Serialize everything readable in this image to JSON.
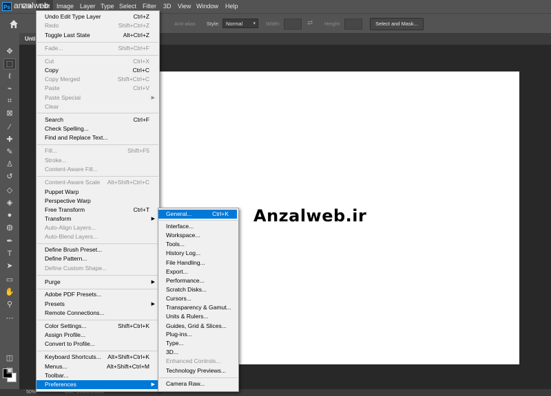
{
  "app": {
    "logo": "Ps",
    "watermark": "anzalweb"
  },
  "menubar": {
    "items": [
      "File",
      "Edit",
      "Image",
      "Layer",
      "Type",
      "Select",
      "Filter",
      "3D",
      "View",
      "Window",
      "Help"
    ]
  },
  "options_bar": {
    "anti_alias": "Anti-alias",
    "style_label": "Style:",
    "style_value": "Normal",
    "width_label": "Width:",
    "height_label": "Height:",
    "select_mask_button": "Select and Mask..."
  },
  "document": {
    "tab_title": "Unti",
    "canvas_text": "Anzalweb.ir"
  },
  "status": {
    "zoom": "50%",
    "doc_info": "Doc: 9/01M/2/00M"
  },
  "edit_menu": {
    "items": [
      {
        "label": "Undo Edit Type Layer",
        "shortcut": "Ctrl+Z"
      },
      {
        "label": "Redo",
        "shortcut": "Shift+Ctrl+Z"
      },
      {
        "label": "Toggle Last State",
        "shortcut": "Alt+Ctrl+Z"
      },
      {
        "label": "Fade...",
        "shortcut": "Shift+Ctrl+F"
      },
      {
        "label": "Cut",
        "shortcut": "Ctrl+X"
      },
      {
        "label": "Copy",
        "shortcut": "Ctrl+C"
      },
      {
        "label": "Copy Merged",
        "shortcut": "Shift+Ctrl+C"
      },
      {
        "label": "Paste",
        "shortcut": "Ctrl+V"
      },
      {
        "label": "Paste Special",
        "shortcut": ""
      },
      {
        "label": "Clear",
        "shortcut": ""
      },
      {
        "label": "Search",
        "shortcut": "Ctrl+F"
      },
      {
        "label": "Check Spelling...",
        "shortcut": ""
      },
      {
        "label": "Find and Replace Text...",
        "shortcut": ""
      },
      {
        "label": "Fill...",
        "shortcut": "Shift+F5"
      },
      {
        "label": "Stroke...",
        "shortcut": ""
      },
      {
        "label": "Content-Aware Fill...",
        "shortcut": ""
      },
      {
        "label": "Content-Aware Scale",
        "shortcut": "Alt+Shift+Ctrl+C"
      },
      {
        "label": "Puppet Warp",
        "shortcut": ""
      },
      {
        "label": "Perspective Warp",
        "shortcut": ""
      },
      {
        "label": "Free Transform",
        "shortcut": "Ctrl+T"
      },
      {
        "label": "Transform",
        "shortcut": ""
      },
      {
        "label": "Auto-Align Layers...",
        "shortcut": ""
      },
      {
        "label": "Auto-Blend Layers...",
        "shortcut": ""
      },
      {
        "label": "Define Brush Preset...",
        "shortcut": ""
      },
      {
        "label": "Define Pattern...",
        "shortcut": ""
      },
      {
        "label": "Define Custom Shape...",
        "shortcut": ""
      },
      {
        "label": "Purge",
        "shortcut": ""
      },
      {
        "label": "Adobe PDF Presets...",
        "shortcut": ""
      },
      {
        "label": "Presets",
        "shortcut": ""
      },
      {
        "label": "Remote Connections...",
        "shortcut": ""
      },
      {
        "label": "Color Settings...",
        "shortcut": "Shift+Ctrl+K"
      },
      {
        "label": "Assign Profile...",
        "shortcut": ""
      },
      {
        "label": "Convert to Profile...",
        "shortcut": ""
      },
      {
        "label": "Keyboard Shortcuts...",
        "shortcut": "Alt+Shift+Ctrl+K"
      },
      {
        "label": "Menus...",
        "shortcut": "Alt+Shift+Ctrl+M"
      },
      {
        "label": "Toolbar...",
        "shortcut": ""
      },
      {
        "label": "Preferences",
        "shortcut": ""
      }
    ]
  },
  "preferences_menu": {
    "items": [
      {
        "label": "General...",
        "shortcut": "Ctrl+K"
      },
      {
        "label": "Interface...",
        "shortcut": ""
      },
      {
        "label": "Workspace...",
        "shortcut": ""
      },
      {
        "label": "Tools...",
        "shortcut": ""
      },
      {
        "label": "History Log...",
        "shortcut": ""
      },
      {
        "label": "File Handling...",
        "shortcut": ""
      },
      {
        "label": "Export...",
        "shortcut": ""
      },
      {
        "label": "Performance...",
        "shortcut": ""
      },
      {
        "label": "Scratch Disks...",
        "shortcut": ""
      },
      {
        "label": "Cursors...",
        "shortcut": ""
      },
      {
        "label": "Transparency & Gamut...",
        "shortcut": ""
      },
      {
        "label": "Units & Rulers...",
        "shortcut": ""
      },
      {
        "label": "Guides, Grid & Slices...",
        "shortcut": ""
      },
      {
        "label": "Plug-ins...",
        "shortcut": ""
      },
      {
        "label": "Type...",
        "shortcut": ""
      },
      {
        "label": "3D...",
        "shortcut": ""
      },
      {
        "label": "Enhanced Controls...",
        "shortcut": ""
      },
      {
        "label": "Technology Previews...",
        "shortcut": ""
      },
      {
        "label": "Camera Raw...",
        "shortcut": ""
      }
    ]
  },
  "tools": [
    "move-tool-icon",
    "marquee-tool-icon",
    "lasso-tool-icon",
    "quick-select-tool-icon",
    "crop-tool-icon",
    "frame-tool-icon",
    "eyedropper-tool-icon",
    "healing-brush-icon",
    "brush-tool-icon",
    "clone-stamp-icon",
    "history-brush-icon",
    "eraser-tool-icon",
    "gradient-tool-icon",
    "blur-tool-icon",
    "dodge-tool-icon",
    "pen-tool-icon",
    "type-tool-icon",
    "path-select-icon",
    "rectangle-tool-icon",
    "hand-tool-icon",
    "zoom-tool-icon"
  ]
}
